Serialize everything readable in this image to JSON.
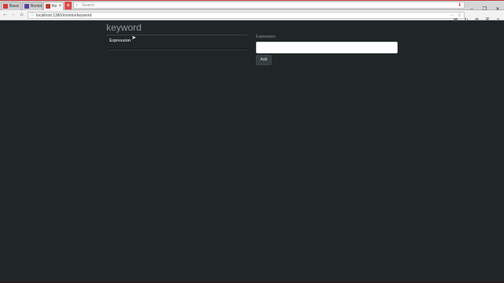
{
  "browser": {
    "tabs": [
      {
        "label": "Basic",
        "active": false,
        "favicon_color": "#d33b3b"
      },
      {
        "label": "Bootst",
        "active": false,
        "favicon_color": "#5a3fa0"
      },
      {
        "label": "Ke",
        "active": true,
        "favicon_color": "#c0392b"
      }
    ],
    "new_tab_label": "+",
    "search_placeholder": "Search",
    "url": "localhost:1380/monitor/keyword",
    "window_controls": [
      "–",
      "❐",
      "✕"
    ]
  },
  "page": {
    "title": "keyword",
    "table": {
      "columns": [
        "Expression"
      ],
      "rows": []
    },
    "form": {
      "label": "Expression",
      "input_value": "",
      "input_placeholder": "",
      "submit_label": "Add"
    }
  }
}
